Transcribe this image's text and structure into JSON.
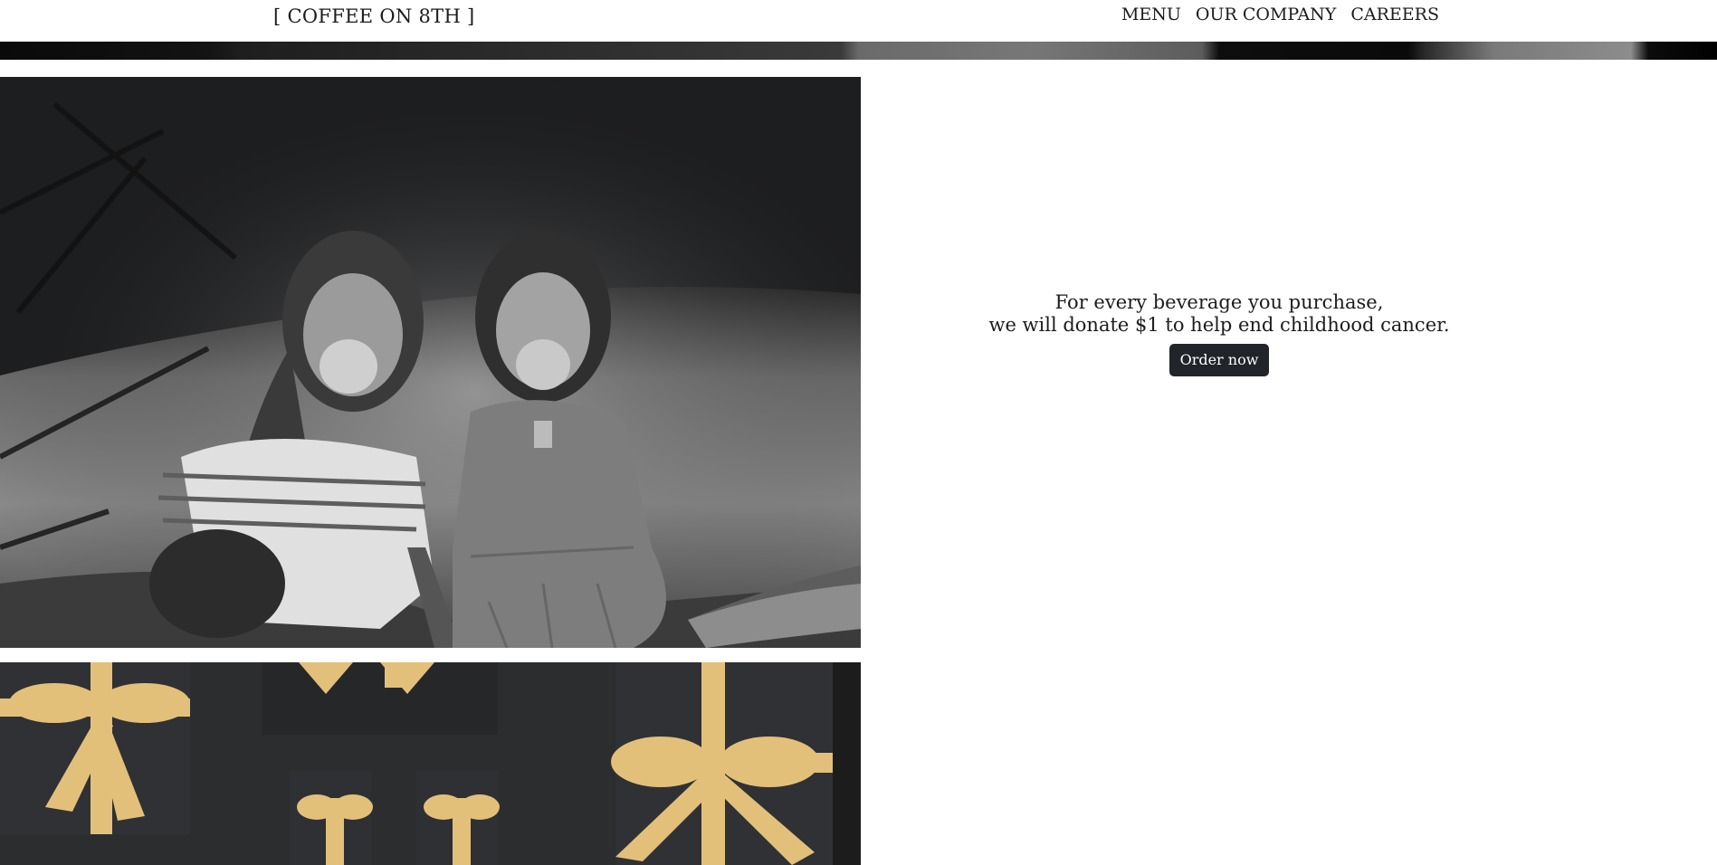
{
  "navbar": {
    "brand": "[ COFFEE ON 8TH ]",
    "links": [
      "MENU",
      "OUR COMPANY",
      "CAREERS"
    ]
  },
  "promo": {
    "line1": "For every beverage you purchase,",
    "line2": "we will donate $1 to help end childhood cancer.",
    "button_label": "Order now"
  },
  "colors": {
    "button_bg": "#212529",
    "ribbon": "#e3c07a",
    "gift_box": "#2c2d2f"
  },
  "images": {
    "photo": "black-and-white photo of two girls covering their mouths while laughing",
    "gifts": "dark gift boxes tied with gold ribbons"
  }
}
